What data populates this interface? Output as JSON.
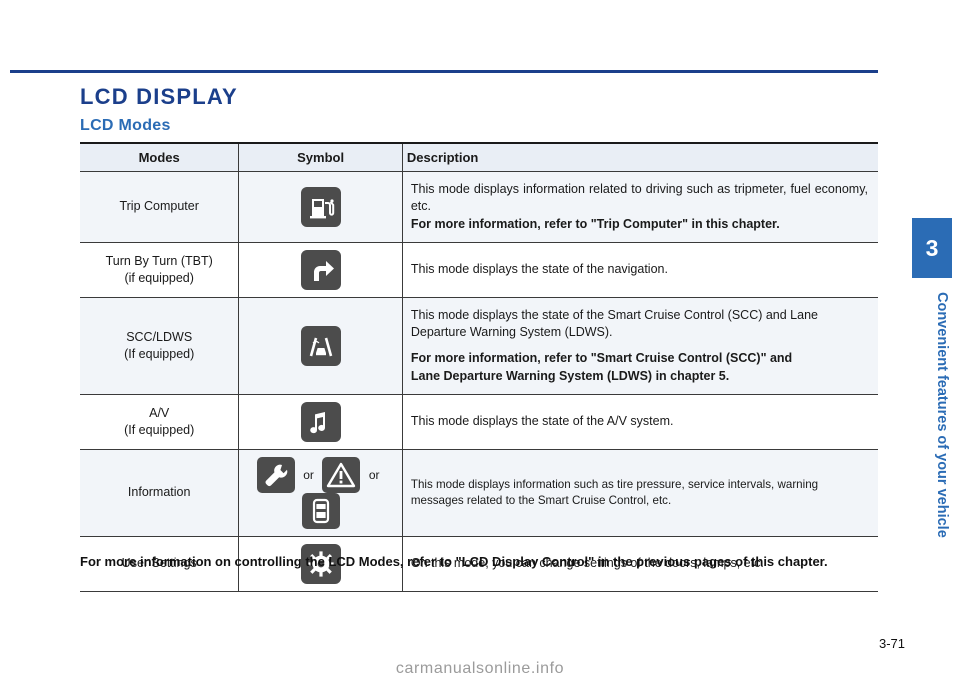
{
  "page": {
    "number": "3-71",
    "side_tab_number": "3",
    "side_tab_text": "Convenient features of your vehicle",
    "watermark": "carmanualsonline.info"
  },
  "headings": {
    "title": "LCD DISPLAY",
    "subtitle": "LCD Modes"
  },
  "table": {
    "headers": {
      "modes": "Modes",
      "symbol": "Symbol",
      "description": "Description"
    },
    "rows": [
      {
        "mode": "Trip Computer",
        "mode_sub": "",
        "icons": [
          "fuel-pump-icon"
        ],
        "desc": "This mode displays information related to driving such as tripmeter, fuel economy, etc.",
        "desc_bold": "For more information, refer to \"Trip Computer\" in this chapter.",
        "desc_bold2": ""
      },
      {
        "mode": "Turn By Turn (TBT)",
        "mode_sub": "(if equipped)",
        "icons": [
          "turn-arrow-icon"
        ],
        "desc": "This mode displays the state of the navigation.",
        "desc_bold": "",
        "desc_bold2": ""
      },
      {
        "mode": "SCC/LDWS",
        "mode_sub": "(If equipped)",
        "icons": [
          "lane-departure-icon"
        ],
        "desc": "This mode displays the state of the Smart Cruise Control (SCC) and Lane Departure Warning System (LDWS).",
        "desc_bold": "For more information, refer to \"Smart Cruise Control (SCC)\" and",
        "desc_bold2": "Lane Departure Warning System (LDWS) in chapter 5."
      },
      {
        "mode": "A/V",
        "mode_sub": "(If equipped)",
        "icons": [
          "music-note-icon"
        ],
        "desc": "This mode displays the state of the A/V system.",
        "desc_bold": "",
        "desc_bold2": ""
      },
      {
        "mode": "Information",
        "mode_sub": "",
        "icons": [
          "wrench-icon",
          "warning-triangle-icon",
          "car-front-icon"
        ],
        "icon_separator": "or",
        "desc": "This mode displays information such as tire pressure, service intervals, warning messages related to the Smart Cruise Control, etc.",
        "desc_bold": "",
        "desc_bold2": ""
      },
      {
        "mode": "User Settings",
        "mode_sub": "",
        "icons": [
          "gear-icon"
        ],
        "desc": "On this mode, you can change settings of the doors, lamps, etc.",
        "desc_bold": "",
        "desc_bold2": ""
      }
    ]
  },
  "note": {
    "line1": "For more information on controlling the LCD Modes, refer to \"LCD Display Control\" in the previous pages of",
    "line2": "this chapter."
  },
  "colors": {
    "heading_dark_blue": "#1b3f8b",
    "heading_blue": "#2b6cb5",
    "table_header_bg": "#e9eef5",
    "row_alt_bg": "#f2f5f9",
    "icon_tile": "#4c4c4c"
  }
}
